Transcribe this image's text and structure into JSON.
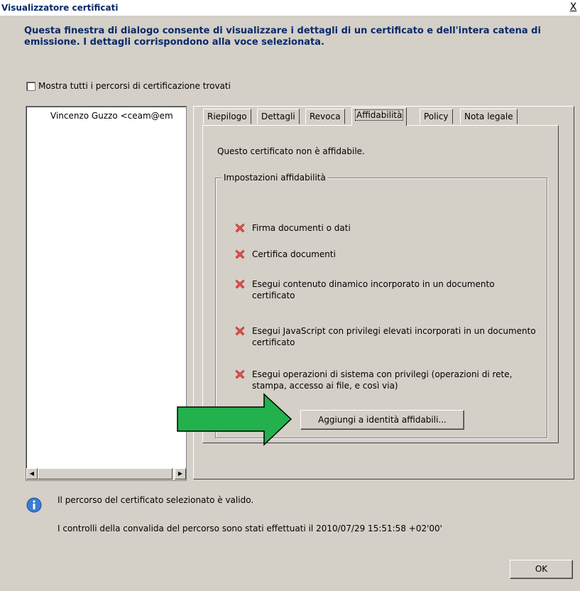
{
  "window": {
    "title": "Visualizzatore certificati",
    "close_label": "X"
  },
  "header": {
    "description": "Questa finestra di dialogo consente di visualizzare i dettagli di un certificato e dell'intera catena di emissione. I dettagli corrispondono alla voce selezionata."
  },
  "show_all_paths": {
    "label": "Mostra tutti i percorsi di certificazione trovati",
    "checked": false
  },
  "tree": {
    "items": [
      {
        "label": "Vincenzo Guzzo <ceam@em"
      }
    ]
  },
  "tabs": [
    {
      "label": "Riepilogo"
    },
    {
      "label": "Dettagli"
    },
    {
      "label": "Revoca"
    },
    {
      "label": "Affidabilità",
      "active": true
    },
    {
      "label": "Policy"
    },
    {
      "label": "Nota legale"
    }
  ],
  "trust": {
    "status": "Questo certificato non è affidabile.",
    "group_label": "Impostazioni affidabilità",
    "permissions": [
      {
        "label": "Firma documenti o dati",
        "icon": "red-x-icon"
      },
      {
        "label": "Certifica documenti",
        "icon": "red-x-icon"
      },
      {
        "label": "Esegui contenuto dinamico incorporato in un documento certificato",
        "icon": "red-x-icon"
      },
      {
        "label": "Esegui JavaScript con privilegi elevati incorporati in un documento certificato",
        "icon": "red-x-icon"
      },
      {
        "label": "Esegui operazioni di sistema con privilegi (operazioni di rete, stampa, accesso ai file, e così via)",
        "icon": "red-x-icon"
      }
    ],
    "add_button": "Aggiungi a identità affidabili..."
  },
  "footer": {
    "valid_text": "Il percorso del certificato selezionato è valido.",
    "checks_text": "I controlli della convalida del percorso sono stati effettuati il 2010/07/29 15:51:58 +02'00'",
    "ok_label": "OK"
  },
  "colors": {
    "title_text": "#0a2a6a",
    "arrow_fill": "#22b14c",
    "x_mark": "#e0504c",
    "dialog_bg": "#d4d0c8"
  }
}
